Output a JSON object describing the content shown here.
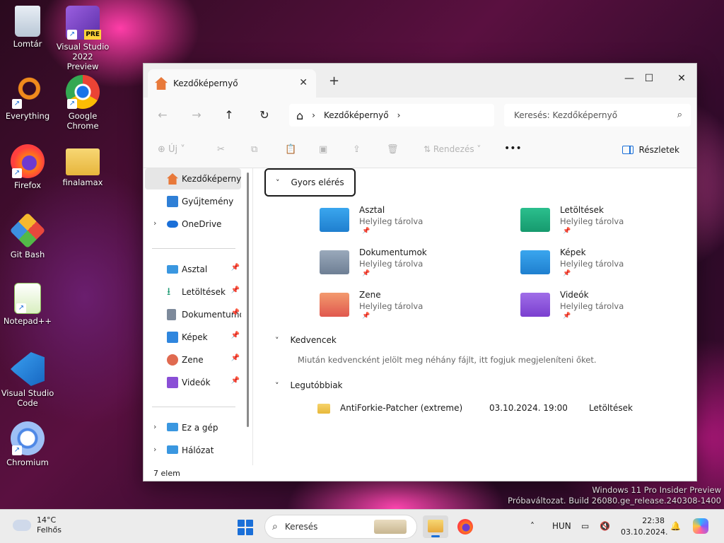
{
  "desktop": {
    "icons": [
      {
        "label": "Lomtár",
        "icon": "recycle-bin-icon"
      },
      {
        "label": "Visual Studio 2022 Preview",
        "icon": "visual-studio-icon",
        "badge": "PRE"
      },
      {
        "label": "Everything",
        "icon": "everything-search-icon"
      },
      {
        "label": "Google Chrome",
        "icon": "chrome-icon"
      },
      {
        "label": "Firefox",
        "icon": "firefox-icon"
      },
      {
        "label": "finalamax",
        "icon": "folder-icon"
      },
      {
        "label": "Git Bash",
        "icon": "git-bash-icon"
      },
      {
        "label": "Notepad++",
        "icon": "notepad-plus-plus-icon"
      },
      {
        "label": "Visual Studio Code",
        "icon": "vscode-icon"
      },
      {
        "label": "Chromium",
        "icon": "chromium-icon"
      }
    ],
    "watermark_line1": "Windows 11 Pro Insider Preview",
    "watermark_line2": "Próbaváltozat. Build 26080.ge_release.240308-1400"
  },
  "explorer": {
    "tab_title": "Kezdőképernyő",
    "tab_close": "✕",
    "new_tab": "+",
    "window_buttons": {
      "minimize": "—",
      "maximize": "☐",
      "close": "✕"
    },
    "nav": {
      "back": "←",
      "forward": "→",
      "up": "↑",
      "refresh": "↻"
    },
    "address": {
      "home": "⌂",
      "sep1": "›",
      "location": "Kezdőképernyő",
      "sep2": "›"
    },
    "search_placeholder": "Keresés: Kezdőképernyő",
    "toolbar": {
      "new_label": "Új",
      "sort_label": "Rendezés",
      "more": "•••",
      "details_label": "Részletek"
    },
    "sidebar": {
      "items": [
        {
          "label": "Kezdőképernyő",
          "icon": "home-icon",
          "color": "#e8793a"
        },
        {
          "label": "Gyűjtemény",
          "icon": "gallery-icon",
          "color": "#2f7fd6"
        },
        {
          "label": "OneDrive",
          "icon": "onedrive-icon",
          "color": "#1a6fd8"
        },
        {
          "label": "Asztal",
          "icon": "desktop-icon",
          "color": "#3a97e0"
        },
        {
          "label": "Letöltések",
          "icon": "download-icon",
          "color": "#1e9b74"
        },
        {
          "label": "Dokumentumok",
          "icon": "documents-icon",
          "color": "#7d8a9b"
        },
        {
          "label": "Képek",
          "icon": "pictures-icon",
          "color": "#2f86de"
        },
        {
          "label": "Zene",
          "icon": "music-icon",
          "color": "#e06a50"
        },
        {
          "label": "Videók",
          "icon": "videos-icon",
          "color": "#8a4fd6"
        },
        {
          "label": "Ez a gép",
          "icon": "this-pc-icon",
          "color": "#3a97e0"
        },
        {
          "label": "Hálózat",
          "icon": "network-icon",
          "color": "#3a97e0"
        }
      ],
      "status": "7 elem"
    },
    "quick_access": {
      "header": "Gyors elérés",
      "items": [
        {
          "name": "Asztal",
          "sub": "Helyileg tárolva",
          "color": "#2b8fe0"
        },
        {
          "name": "Letöltések",
          "sub": "Helyileg tárolva",
          "color": "#1fa57e"
        },
        {
          "name": "Dokumentumok",
          "sub": "Helyileg tárolva",
          "color": "#7d8da2"
        },
        {
          "name": "Képek",
          "sub": "Helyileg tárolva",
          "color": "#2b8fe0"
        },
        {
          "name": "Zene",
          "sub": "Helyileg tárolva",
          "color": "#e8735c"
        },
        {
          "name": "Videók",
          "sub": "Helyileg tárolva",
          "color": "#8a4fd6"
        }
      ]
    },
    "favorites": {
      "header": "Kedvencek",
      "empty_text": "Miután kedvencként jelölt meg néhány fájlt, itt fogjuk megjeleníteni őket."
    },
    "recent": {
      "header": "Legutóbbiak",
      "items": [
        {
          "name": "AntiForkie-Patcher (extreme)",
          "date": "03.10.2024. 19:00",
          "location": "Letöltések"
        }
      ]
    }
  },
  "taskbar": {
    "weather_temp": "14°C",
    "weather_desc": "Felhős",
    "search_placeholder": "Keresés",
    "lang": "HUN",
    "time": "22:38",
    "date": "03.10.2024."
  }
}
